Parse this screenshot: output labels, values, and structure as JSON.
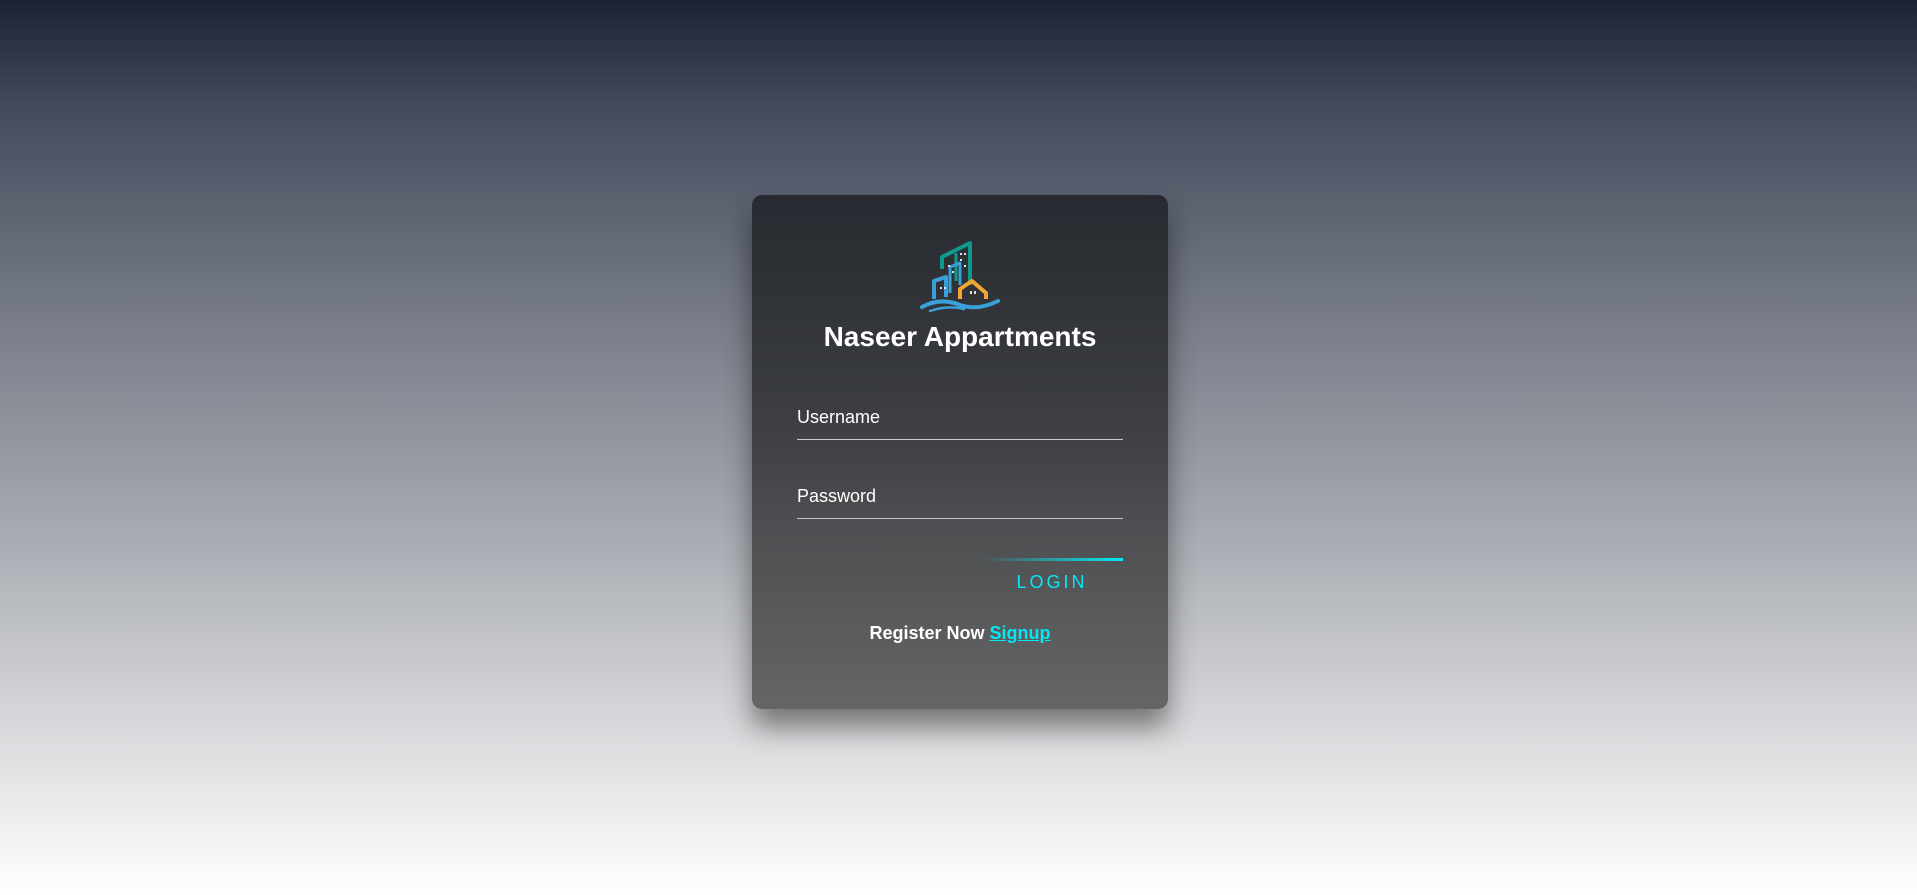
{
  "app": {
    "title": "Naseer Appartments",
    "logo_icon": "building-logo-icon"
  },
  "form": {
    "username_placeholder": "Username",
    "password_placeholder": "Password",
    "login_label": "LOGIN"
  },
  "register": {
    "text": "Register Now",
    "link_label": "Signup"
  },
  "colors": {
    "accent": "#03e9f4",
    "logo_teal": "#0e9a8c",
    "logo_blue": "#3aa0d8",
    "logo_orange": "#f2a531"
  }
}
